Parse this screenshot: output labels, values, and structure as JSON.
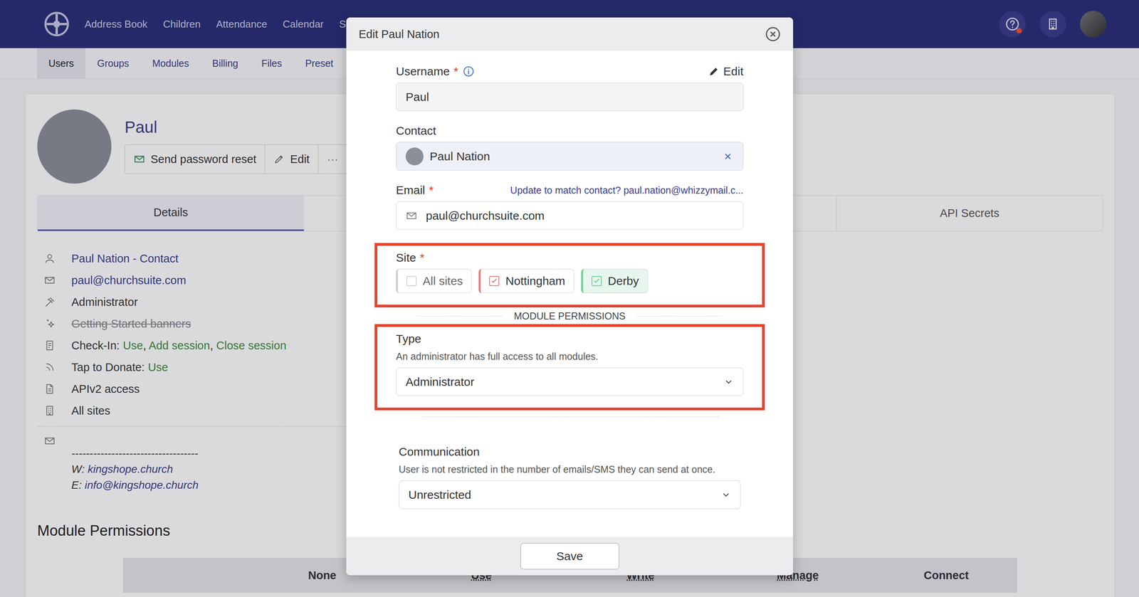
{
  "nav": {
    "items": [
      "Address Book",
      "Children",
      "Attendance",
      "Calendar",
      "S"
    ]
  },
  "subnav": {
    "items": [
      {
        "label": "Users",
        "selected": true
      },
      {
        "label": "Groups",
        "selected": false
      },
      {
        "label": "Modules",
        "selected": false
      },
      {
        "label": "Billing",
        "selected": false
      },
      {
        "label": "Files",
        "selected": false
      },
      {
        "label": "Preset",
        "selected": false
      }
    ]
  },
  "notifications": {
    "unread": true
  },
  "user": {
    "name": "Paul",
    "actions": [
      "Send password reset",
      "Edit",
      "···"
    ]
  },
  "tabs": [
    {
      "label": "Details",
      "selected": true
    },
    {
      "label": "API Secrets",
      "selected": false
    }
  ],
  "details": [
    {
      "kind": "link",
      "text": "Paul Nation - Contact"
    },
    {
      "kind": "link",
      "text": "paul@churchsuite.com"
    },
    {
      "kind": "text",
      "text": "Administrator"
    },
    {
      "kind": "disabled",
      "text": "Getting Started banners"
    },
    {
      "kind": "perms",
      "text": "Check-In:",
      "values": [
        "Use",
        "Add session",
        "Close session"
      ]
    },
    {
      "kind": "perms",
      "text": "Tap to Donate:",
      "values": [
        "Use"
      ]
    },
    {
      "kind": "text",
      "text": "APIv2 access"
    },
    {
      "kind": "text",
      "text": "All sites"
    }
  ],
  "value_separator": ", ",
  "signature": {
    "rule": "-----------------------------------",
    "lines": [
      {
        "prefix": "W: ",
        "link": "kingshope.church"
      },
      {
        "prefix": "E: ",
        "link": "info@kingshope.church"
      }
    ]
  },
  "permissions": {
    "title": "Module Permissions",
    "columns": [
      {
        "label": "None",
        "underlined": false
      },
      {
        "label": "Use",
        "underlined": true
      },
      {
        "label": "Write",
        "underlined": true
      },
      {
        "label": "Manage",
        "underlined": true
      },
      {
        "label": "Connect",
        "underlined": false
      }
    ]
  },
  "modal": {
    "title": "Edit Paul Nation",
    "required_mark": "*",
    "username": {
      "label": "Username",
      "required": true,
      "edit": "Edit",
      "value": "Paul"
    },
    "contact": {
      "label": "Contact",
      "required": false,
      "value": "Paul Nation"
    },
    "email": {
      "label": "Email",
      "required": true,
      "link": "Update to match contact? paul.nation@whizzymail.c...",
      "value": "paul@churchsuite.com"
    },
    "site": {
      "label": "Site",
      "required": true,
      "highlighted": true,
      "options": [
        {
          "label": "All sites",
          "checked": false,
          "tinted": false,
          "color": "#d0d0d0"
        },
        {
          "label": "Nottingham",
          "checked": true,
          "tinted": false,
          "color": "#e07b7b"
        },
        {
          "label": "Derby",
          "checked": true,
          "tinted": true,
          "color": "#6fcf97"
        }
      ]
    },
    "divider": "MODULE PERMISSIONS",
    "type": {
      "label": "Type",
      "highlighted": true,
      "help": "An administrator has full access to all modules.",
      "value": "Administrator"
    },
    "communication": {
      "label": "Communication",
      "highlighted": false,
      "help": "User is not restricted in the number of emails/SMS they can send at once.",
      "value": "Unrestricted"
    },
    "save": "Save"
  }
}
